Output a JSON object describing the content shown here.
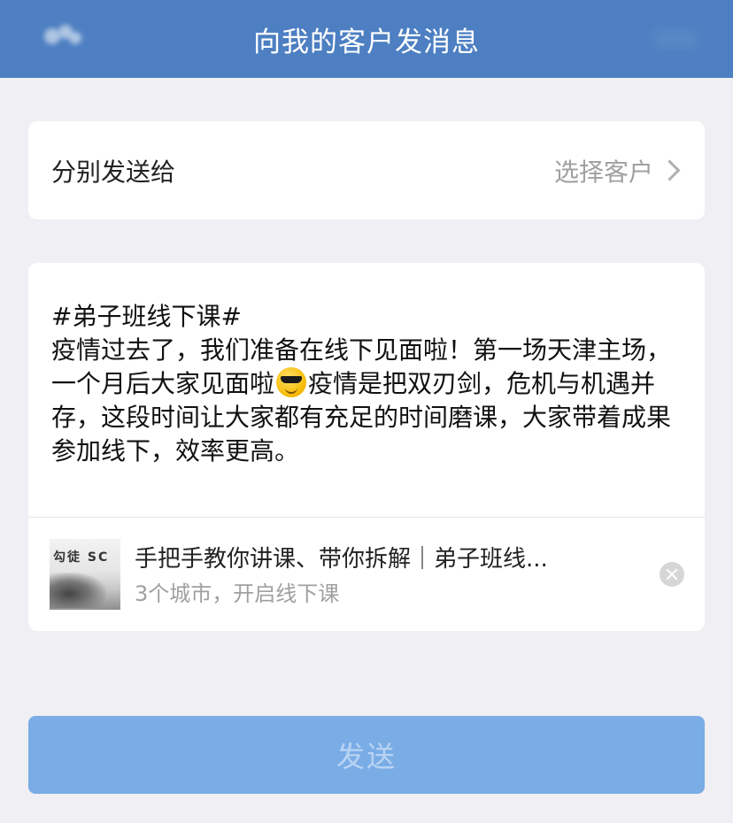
{
  "header": {
    "title": "向我的客户发消息",
    "back_icon": "back-icon",
    "background": "#4d7fc2"
  },
  "recipient": {
    "label": "分别发送给",
    "placeholder": "选择客户",
    "chevron_icon": "chevron-right-icon"
  },
  "message": {
    "line1": "#弟子班线下课#",
    "part_before_emoji": "疫情过去了，我们准备在线下见面啦！第一场天津主场，一个月后大家见面啦",
    "emoji": "sunglasses-emoji",
    "part_after_emoji": "疫情是把双刃剑，危机与机遇并存，这段时间让大家都有充足的时间磨课，大家带着成果参加线下，效率更高。"
  },
  "link_preview": {
    "thumb_text": "勾徒 SC",
    "title": "手把手教你讲课、带你拆解｜弟子班线...",
    "subtitle": "3个城市，开启线下课",
    "remove_icon": "close-circle-icon"
  },
  "send": {
    "label": "发送",
    "color": "#7aace6"
  }
}
